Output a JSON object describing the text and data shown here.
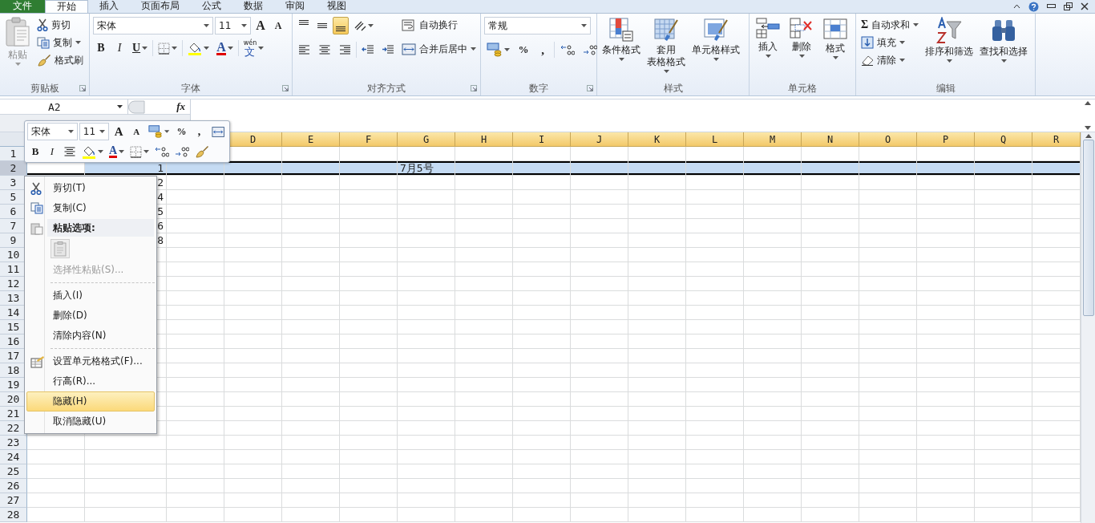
{
  "tabs": [
    {
      "label": "文件",
      "kind": "file",
      "selected": false
    },
    {
      "label": "开始",
      "kind": "tab",
      "selected": true
    },
    {
      "label": "插入",
      "kind": "tab",
      "selected": false
    },
    {
      "label": "页面布局",
      "kind": "tab",
      "selected": false
    },
    {
      "label": "公式",
      "kind": "tab",
      "selected": false
    },
    {
      "label": "数据",
      "kind": "tab",
      "selected": false
    },
    {
      "label": "审阅",
      "kind": "tab",
      "selected": false
    },
    {
      "label": "视图",
      "kind": "tab",
      "selected": false
    }
  ],
  "ribbon": {
    "groups": [
      {
        "kind": "clipboard",
        "title": "剪贴板",
        "paste": "粘贴",
        "commands": [
          "剪切",
          "复制",
          "格式刷"
        ]
      },
      {
        "kind": "font",
        "title": "字体",
        "font": "宋体",
        "size": "11",
        "grow": "A",
        "shrink": "A",
        "bold": "B",
        "italic": "I",
        "underline": "U",
        "font_color": "A",
        "phonetic_top": "wén",
        "phonetic": "文"
      },
      {
        "kind": "alignment",
        "title": "对齐方式",
        "wrap": "自动换行",
        "merge": "合并后居中",
        "vertical_align": [
          {
            "selected": false
          },
          {
            "selected": false
          },
          {
            "selected": true
          }
        ]
      },
      {
        "kind": "number",
        "title": "数字",
        "format": "常规",
        "percent": "%",
        "comma": ","
      },
      {
        "kind": "styles",
        "title": "样式",
        "buttons": [
          {
            "lines": [
              "条件格式"
            ]
          },
          {
            "lines": [
              "套用",
              "表格格式"
            ]
          },
          {
            "lines": [
              "单元格样式"
            ]
          }
        ]
      },
      {
        "kind": "cells",
        "title": "单元格",
        "buttons": [
          "插入",
          "删除",
          "格式"
        ]
      },
      {
        "kind": "editing",
        "title": "编辑",
        "sum_glyph": "Σ",
        "commands": [
          "自动求和",
          "填充",
          "清除"
        ],
        "buttons": [
          "排序和筛选",
          "查找和选择"
        ]
      }
    ]
  },
  "formula_bar": {
    "name_box": "A2",
    "fx": "fx"
  },
  "sheet": {
    "columns": [
      "D",
      "E",
      "F",
      "G",
      "H",
      "I",
      "J",
      "K",
      "L",
      "M",
      "N",
      "O",
      "P",
      "Q",
      "R"
    ],
    "rows": [
      {
        "header": "1",
        "selected": false
      },
      {
        "header": "2",
        "selected": true,
        "column_2": "1",
        "column_7": "7月5号"
      },
      {
        "header": "3",
        "selected": false,
        "column_2": "2"
      },
      {
        "header": "5",
        "selected": false,
        "column_2": "4"
      },
      {
        "header": "6",
        "selected": false,
        "column_2": "5"
      },
      {
        "header": "7",
        "selected": false,
        "column_2": "6"
      },
      {
        "header": "9",
        "selected": false,
        "column_2": "8"
      },
      {
        "header": "10",
        "selected": false
      },
      {
        "header": "11",
        "selected": false
      },
      {
        "header": "12",
        "selected": false
      },
      {
        "header": "13",
        "selected": false
      },
      {
        "header": "14",
        "selected": false
      },
      {
        "header": "15",
        "selected": false
      },
      {
        "header": "16",
        "selected": false
      },
      {
        "header": "17",
        "selected": false
      },
      {
        "header": "18",
        "selected": false
      },
      {
        "header": "19",
        "selected": false
      },
      {
        "header": "20",
        "selected": false
      },
      {
        "header": "21",
        "selected": false
      },
      {
        "header": "22",
        "selected": false
      },
      {
        "header": "23",
        "selected": false
      },
      {
        "header": "24",
        "selected": false
      },
      {
        "header": "25",
        "selected": false
      },
      {
        "header": "26",
        "selected": false
      },
      {
        "header": "27",
        "selected": false
      },
      {
        "header": "28",
        "selected": false
      }
    ]
  },
  "mini_toolbar": {
    "font": "宋体",
    "size": "11",
    "grow": "A",
    "shrink": "A",
    "percent": "%",
    "comma": ",",
    "bold": "B",
    "italic": "I",
    "font_color": "A"
  },
  "context_menu": [
    {
      "kind": "item",
      "label": "剪切(T)",
      "disabled": false,
      "selected": false
    },
    {
      "kind": "item",
      "label": "复制(C)",
      "disabled": false,
      "selected": false
    },
    {
      "kind": "header",
      "label": "粘贴选项:"
    },
    {
      "kind": "paste_option"
    },
    {
      "kind": "item",
      "label": "选择性粘贴(S)...",
      "disabled": true,
      "selected": false
    },
    {
      "kind": "separator"
    },
    {
      "kind": "item",
      "label": "插入(I)",
      "disabled": false,
      "selected": false
    },
    {
      "kind": "item",
      "label": "删除(D)",
      "disabled": false,
      "selected": false
    },
    {
      "kind": "item",
      "label": "清除内容(N)",
      "disabled": false,
      "selected": false
    },
    {
      "kind": "separator"
    },
    {
      "kind": "item",
      "label": "设置单元格格式(F)...",
      "disabled": false,
      "selected": false
    },
    {
      "kind": "item",
      "label": "行高(R)...",
      "disabled": false,
      "selected": false
    },
    {
      "kind": "item",
      "label": "隐藏(H)",
      "disabled": false,
      "selected": true
    },
    {
      "kind": "item",
      "label": "取消隐藏(U)",
      "disabled": false,
      "selected": false
    }
  ]
}
